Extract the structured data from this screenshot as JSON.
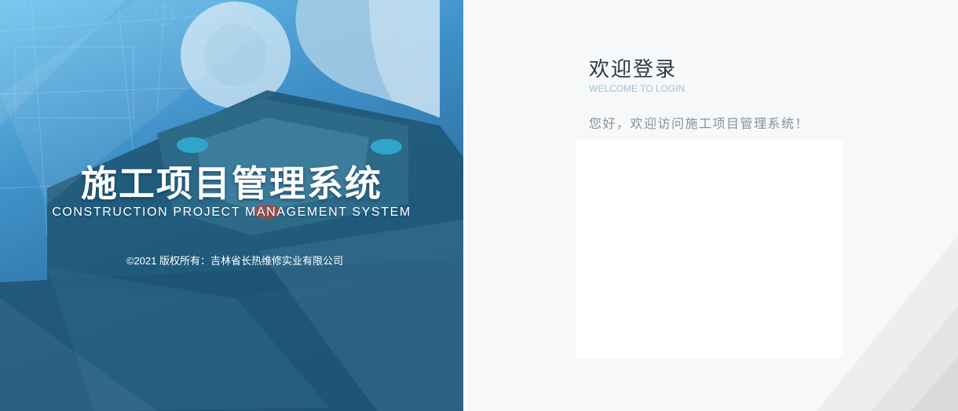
{
  "banner": {
    "title": "施工项目管理系统",
    "subtitle": "CONSTRUCTION PROJECT MANAGEMENT SYSTEM",
    "copyright": "©2021 版权所有：吉林省长热维修实业有限公司"
  },
  "login": {
    "title": "欢迎登录",
    "subtitle": "WELCOME TO LOGIN",
    "greeting": "您好，欢迎访问施工项目管理系统！"
  },
  "colors": {
    "banner_blue": "#3f8fc7",
    "title_text": "#2b3a44",
    "sub_text": "#a7bfcf",
    "greeting_text": "#8a9196",
    "page_bg": "#f6f8f9"
  }
}
